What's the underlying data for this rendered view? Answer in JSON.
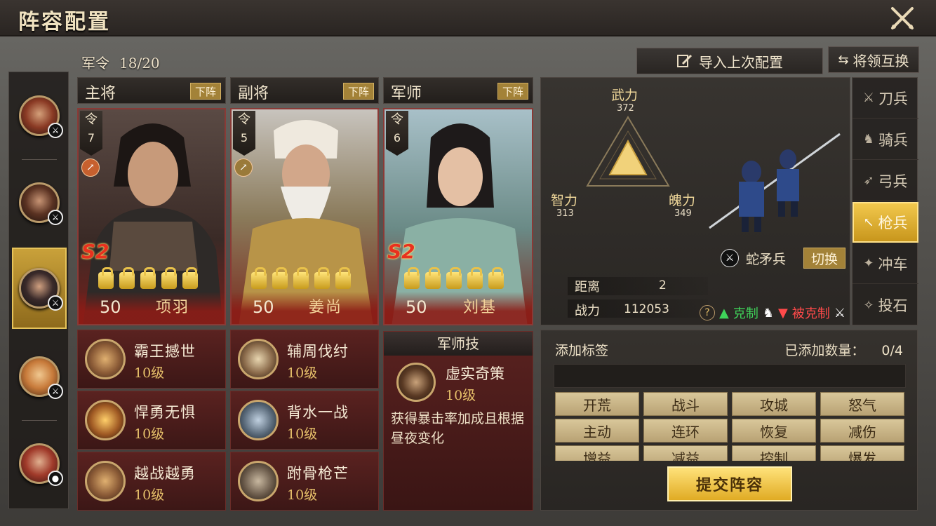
{
  "header": {
    "title": "阵容配置"
  },
  "toolbar": {
    "order_label": "军令",
    "order_value": "18/20",
    "import_label": "导入上次配置",
    "swap_label": "将领互换"
  },
  "slots": [
    {
      "role": "主将",
      "down_label": "下阵",
      "ling_label": "令",
      "cost": "7",
      "rank": "S2",
      "level": "50",
      "name": "项羽",
      "skills": [
        {
          "name": "霸王撼世",
          "level": "10级"
        },
        {
          "name": "悍勇无惧",
          "level": "10级"
        },
        {
          "name": "越战越勇",
          "level": "10级"
        }
      ]
    },
    {
      "role": "副将",
      "down_label": "下阵",
      "ling_label": "令",
      "cost": "5",
      "rank": "",
      "level": "50",
      "name": "姜尚",
      "skills": [
        {
          "name": "辅周伐纣",
          "level": "10级"
        },
        {
          "name": "背水一战",
          "level": "10级"
        },
        {
          "name": "跗骨枪芒",
          "level": "10级"
        }
      ]
    },
    {
      "role": "军师",
      "down_label": "下阵",
      "ling_label": "令",
      "cost": "6",
      "rank": "S2",
      "level": "50",
      "name": "刘基"
    }
  ],
  "strategist_skill": {
    "header": "军师技",
    "name": "虚实奇策",
    "level": "10级",
    "desc": "获得暴击率加成且根据昼夜变化"
  },
  "stats": {
    "force_label": "武力",
    "force_value": "372",
    "intel_label": "智力",
    "intel_value": "313",
    "spirit_label": "魄力",
    "spirit_value": "349"
  },
  "troop": {
    "name": "蛇矛兵",
    "switch_label": "切换",
    "range_label": "距离",
    "range_value": "2",
    "power_label": "战力",
    "power_value": "112053",
    "help": "?",
    "counter_label": "克制",
    "countered_label": "被克制"
  },
  "troop_tabs": [
    {
      "label": "刀兵",
      "icon": "sword-icon",
      "active": false
    },
    {
      "label": "骑兵",
      "icon": "horse-icon",
      "active": false
    },
    {
      "label": "弓兵",
      "icon": "bow-icon",
      "active": false
    },
    {
      "label": "枪兵",
      "icon": "spear-icon",
      "active": true
    },
    {
      "label": "冲车",
      "icon": "ram-icon",
      "active": false
    },
    {
      "label": "投石",
      "icon": "catapult-icon",
      "active": false
    }
  ],
  "tags": {
    "add_label": "添加标签",
    "count_label": "已添加数量：",
    "count_value": "0/4",
    "items": [
      "开荒",
      "战斗",
      "攻城",
      "怒气",
      "主动",
      "连环",
      "恢复",
      "减伤",
      "增益",
      "减益",
      "控制",
      "爆发"
    ],
    "submit_label": "提交阵容"
  },
  "colors": {
    "accent_gold": "#c8961c",
    "card_red": "#8a3a36",
    "counter_green": "#3fd45a",
    "counter_red": "#ff4a4a"
  }
}
